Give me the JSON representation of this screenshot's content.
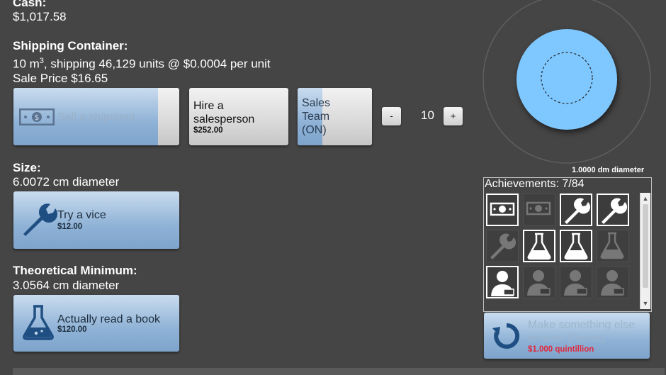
{
  "cash": {
    "label": "Cash:",
    "value": "$1,017.58"
  },
  "shipping": {
    "heading": "Shipping Container:",
    "size_prefix": "10 m",
    "size_sup": "3",
    "size_rest": ", shipping 46,129 units @ $0.0004 per unit",
    "sale_price": "Sale Price $16.65",
    "sell_button": {
      "label": "Sell a shipment",
      "progress": 0.87
    },
    "hire_button": {
      "label": "Hire a salesperson",
      "cost": "$252.00"
    },
    "sales_team_button": {
      "label": "Sales Team (ON)",
      "progress": 0.33
    },
    "stepper": {
      "minus": "-",
      "value": "10",
      "plus": "+"
    }
  },
  "size": {
    "heading": "Size:",
    "value": "6.0072 cm diameter",
    "button": {
      "label": "Try a vice",
      "cost": "$12.00"
    }
  },
  "theoretical": {
    "heading": "Theoretical Minimum:",
    "value": "3.0564 cm diameter",
    "button": {
      "label": "Actually read a book",
      "cost": "$120.00"
    }
  },
  "visual": {
    "caption": "1.0000 dm diameter",
    "object_color": "#7fc8ff"
  },
  "achievements": {
    "title": "Achievements: 7/84",
    "tiles": [
      {
        "icon": "money-icon",
        "unlocked": true
      },
      {
        "icon": "money-icon",
        "unlocked": false
      },
      {
        "icon": "wrench-icon",
        "unlocked": true
      },
      {
        "icon": "wrench-icon",
        "unlocked": true
      },
      {
        "icon": "wrench-icon",
        "unlocked": false
      },
      {
        "icon": "flask-icon",
        "unlocked": true
      },
      {
        "icon": "flask-icon",
        "unlocked": true
      },
      {
        "icon": "flask-icon",
        "unlocked": false
      },
      {
        "icon": "salesperson-icon",
        "unlocked": true
      },
      {
        "icon": "salesperson-icon",
        "unlocked": false
      },
      {
        "icon": "salesperson-icon",
        "unlocked": false
      },
      {
        "icon": "salesperson-icon",
        "unlocked": false
      }
    ]
  },
  "reset": {
    "label": "Make something else smaller (Reset)",
    "cost": "$1.000 quintillion",
    "cost_color": "#e0283c"
  }
}
